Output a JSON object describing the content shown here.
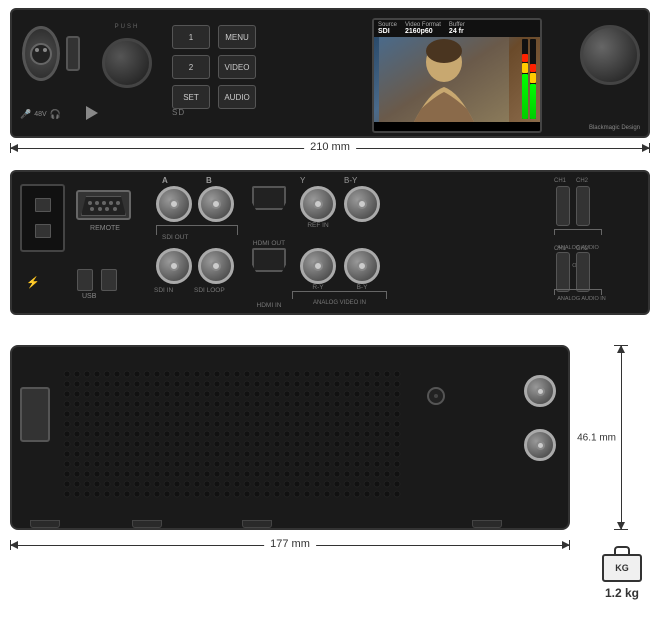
{
  "device": {
    "brand": "Blackmagic Design",
    "dimensions": {
      "width_mm": "210 mm",
      "height_mm": "46.1 mm",
      "depth_mm": "177 mm"
    },
    "weight": "1.2 kg"
  },
  "front_panel": {
    "push_label": "PUSH",
    "voltage_label": "48V",
    "headphone_label": "🎧",
    "mic_label": "🎤",
    "sd_label": "SD",
    "buttons": {
      "b1": "1",
      "b2": "2",
      "set": "SET",
      "menu": "MENU",
      "video": "VIDEO",
      "audio": "AUDIO"
    },
    "display": {
      "source_label": "Source",
      "source_value": "SDI",
      "format_label": "Video Format",
      "format_value": "2160p60",
      "buffer_label": "Buffer",
      "buffer_value": "24 fr"
    }
  },
  "rear_panel": {
    "remote_label": "REMOTE",
    "usb_label": "USB",
    "thunderbolt_label": "⚡",
    "connectors": {
      "col_a": "A",
      "col_b": "B",
      "sdi_out_label": "SDI OUT",
      "sdi_in_label": "SDI IN",
      "sdi_loop_label": "SDI LOOP",
      "hdmi_out_label": "HDMI OUT",
      "hdmi_in_label": "HDMI IN",
      "ref_in_label": "REF IN",
      "r_y_label": "R-Y",
      "y_label": "Y",
      "b_y_label": "B-Y",
      "analog_video_in_label": "ANALOG VIDEO IN",
      "analog_audio_out_ch1": "CH1",
      "analog_audio_out_ch2": "CH2",
      "analog_audio_out_label": "ANALOG AUDIO OUT",
      "analog_audio_in_ch1": "CH1",
      "analog_audio_in_ch2": "CH2",
      "analog_audio_in_label": "ANALOG AUDIO IN"
    }
  },
  "icons": {
    "mic": "🎤",
    "headphone": "🎧",
    "thunderbolt": "⚡",
    "weight": "KG"
  }
}
